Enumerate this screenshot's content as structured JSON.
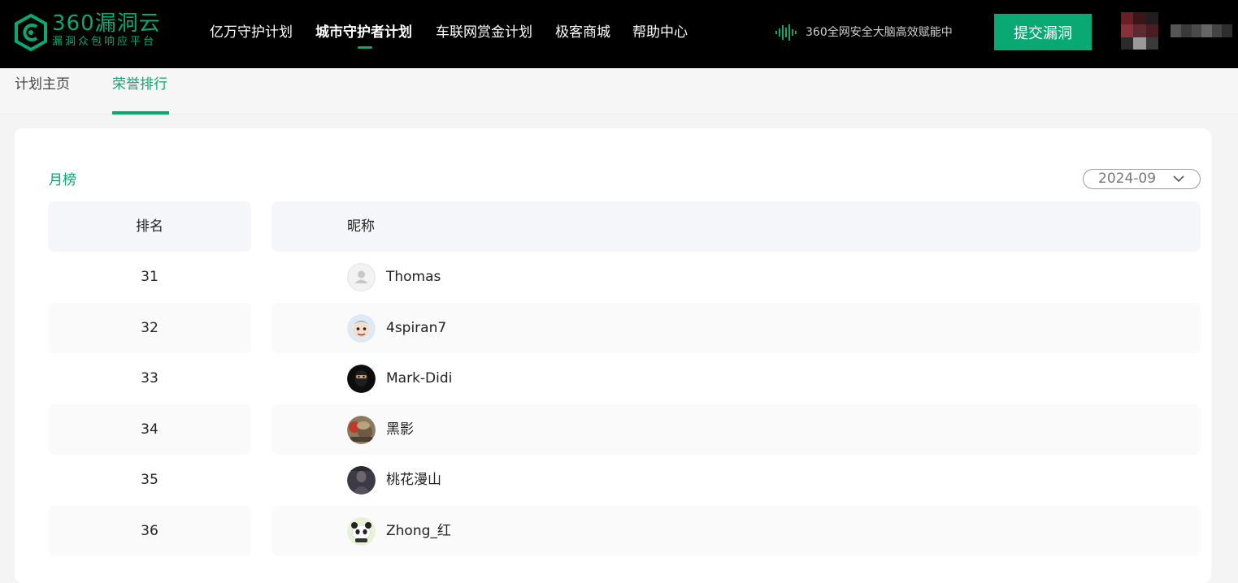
{
  "header": {
    "logo": {
      "title": "360漏洞云",
      "subtitle": "漏洞众包响应平台"
    },
    "nav": [
      {
        "label": "亿万守护计划",
        "active": false
      },
      {
        "label": "城市守护者计划",
        "active": true
      },
      {
        "label": "车联网赏金计划",
        "active": false
      },
      {
        "label": "极客商城",
        "active": false
      },
      {
        "label": "帮助中心",
        "active": false
      }
    ],
    "brain_text": "360全网安全大脑高效赋能中",
    "submit_label": "提交漏洞"
  },
  "subnav": {
    "tabs": [
      {
        "label": "计划主页",
        "active": false
      },
      {
        "label": "荣誉排行",
        "active": true
      }
    ]
  },
  "ranking": {
    "title": "月榜",
    "month": "2024-09",
    "columns": {
      "rank": "排名",
      "nickname": "昵称"
    },
    "rows": [
      {
        "rank": "31",
        "nickname": "Thomas",
        "avatar": "default-user-avatar"
      },
      {
        "rank": "32",
        "nickname": "4spiran7",
        "avatar": "cartoon-avatar"
      },
      {
        "rank": "33",
        "nickname": "Mark-Didi",
        "avatar": "masked-figure-avatar"
      },
      {
        "rank": "34",
        "nickname": "黑影",
        "avatar": "photo-avatar"
      },
      {
        "rank": "35",
        "nickname": "桃花漫山",
        "avatar": "dark-photo-avatar"
      },
      {
        "rank": "36",
        "nickname": "Zhong_红",
        "avatar": "panda-avatar"
      }
    ]
  },
  "colors": {
    "brand": "#0aa872",
    "header_bg": "#000000"
  }
}
